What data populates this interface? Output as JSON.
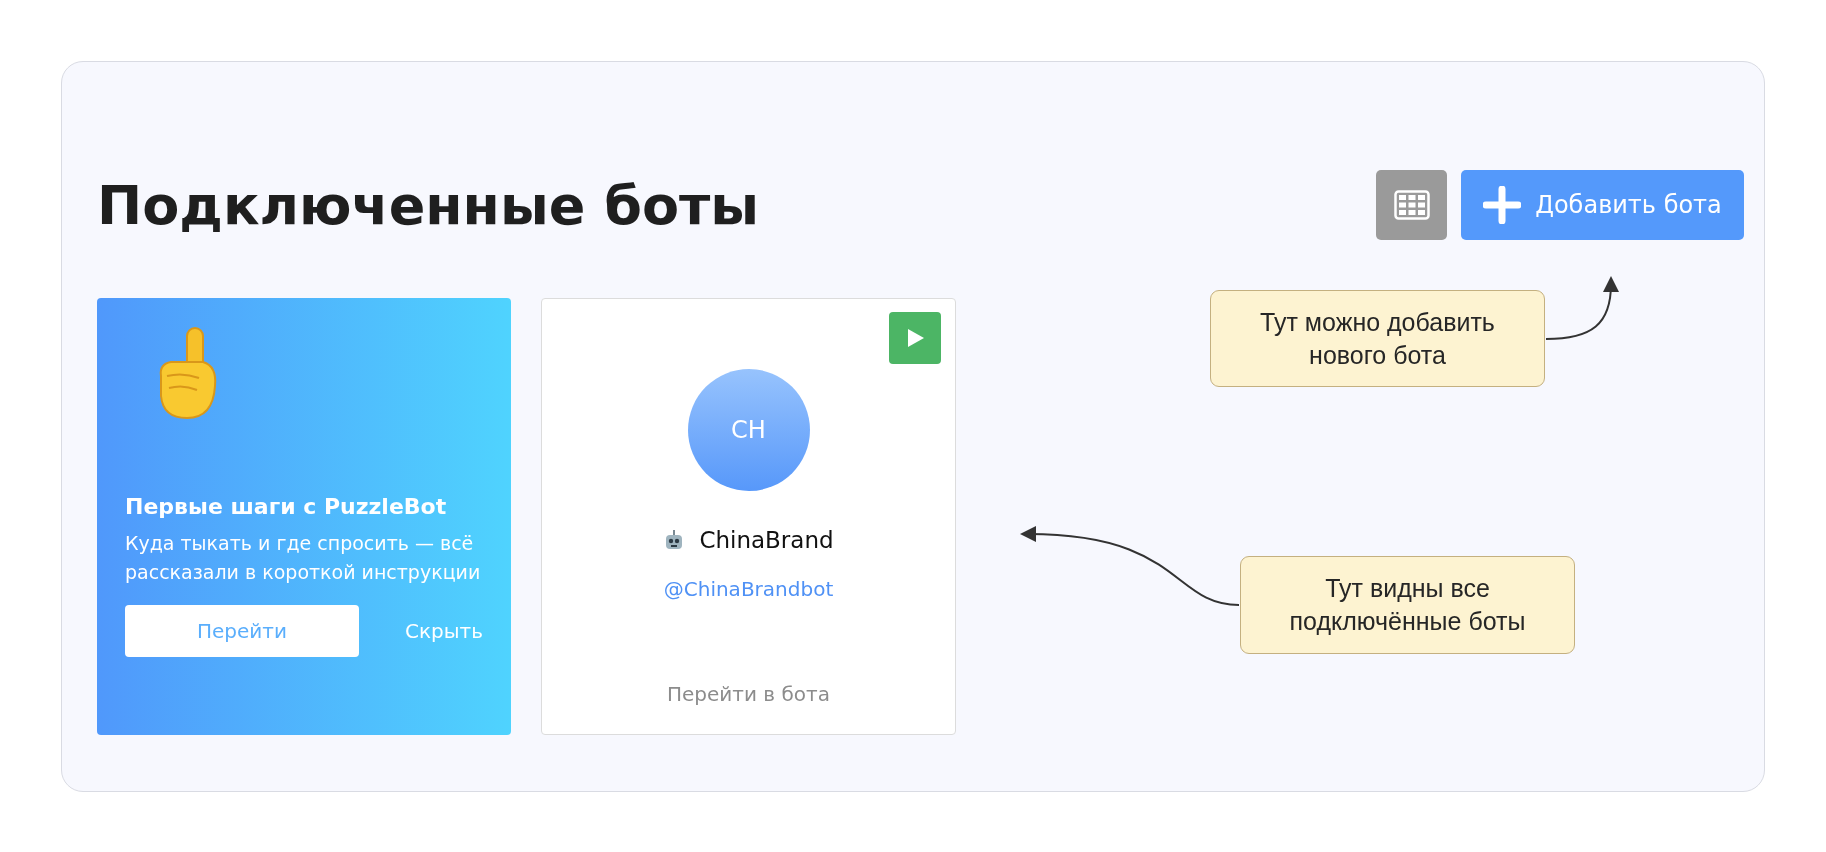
{
  "title": "Подключенные боты",
  "toolbar": {
    "add_button": "Добавить бота"
  },
  "onboarding_card": {
    "title": "Первые шаги с PuzzleBot",
    "text": "Куда тыкать и где спросить — всё рассказали в короткой инструкции",
    "go_button": "Перейти",
    "hide_button": "Скрыть"
  },
  "bots": [
    {
      "initials": "CH",
      "name": "ChinaBrand",
      "username": "@ChinaBrandbot",
      "open_link": "Перейти в бота"
    }
  ],
  "callouts": [
    {
      "text": "Тут можно добавить нового бота"
    },
    {
      "text": "Тут видны все подключённые боты"
    }
  ]
}
